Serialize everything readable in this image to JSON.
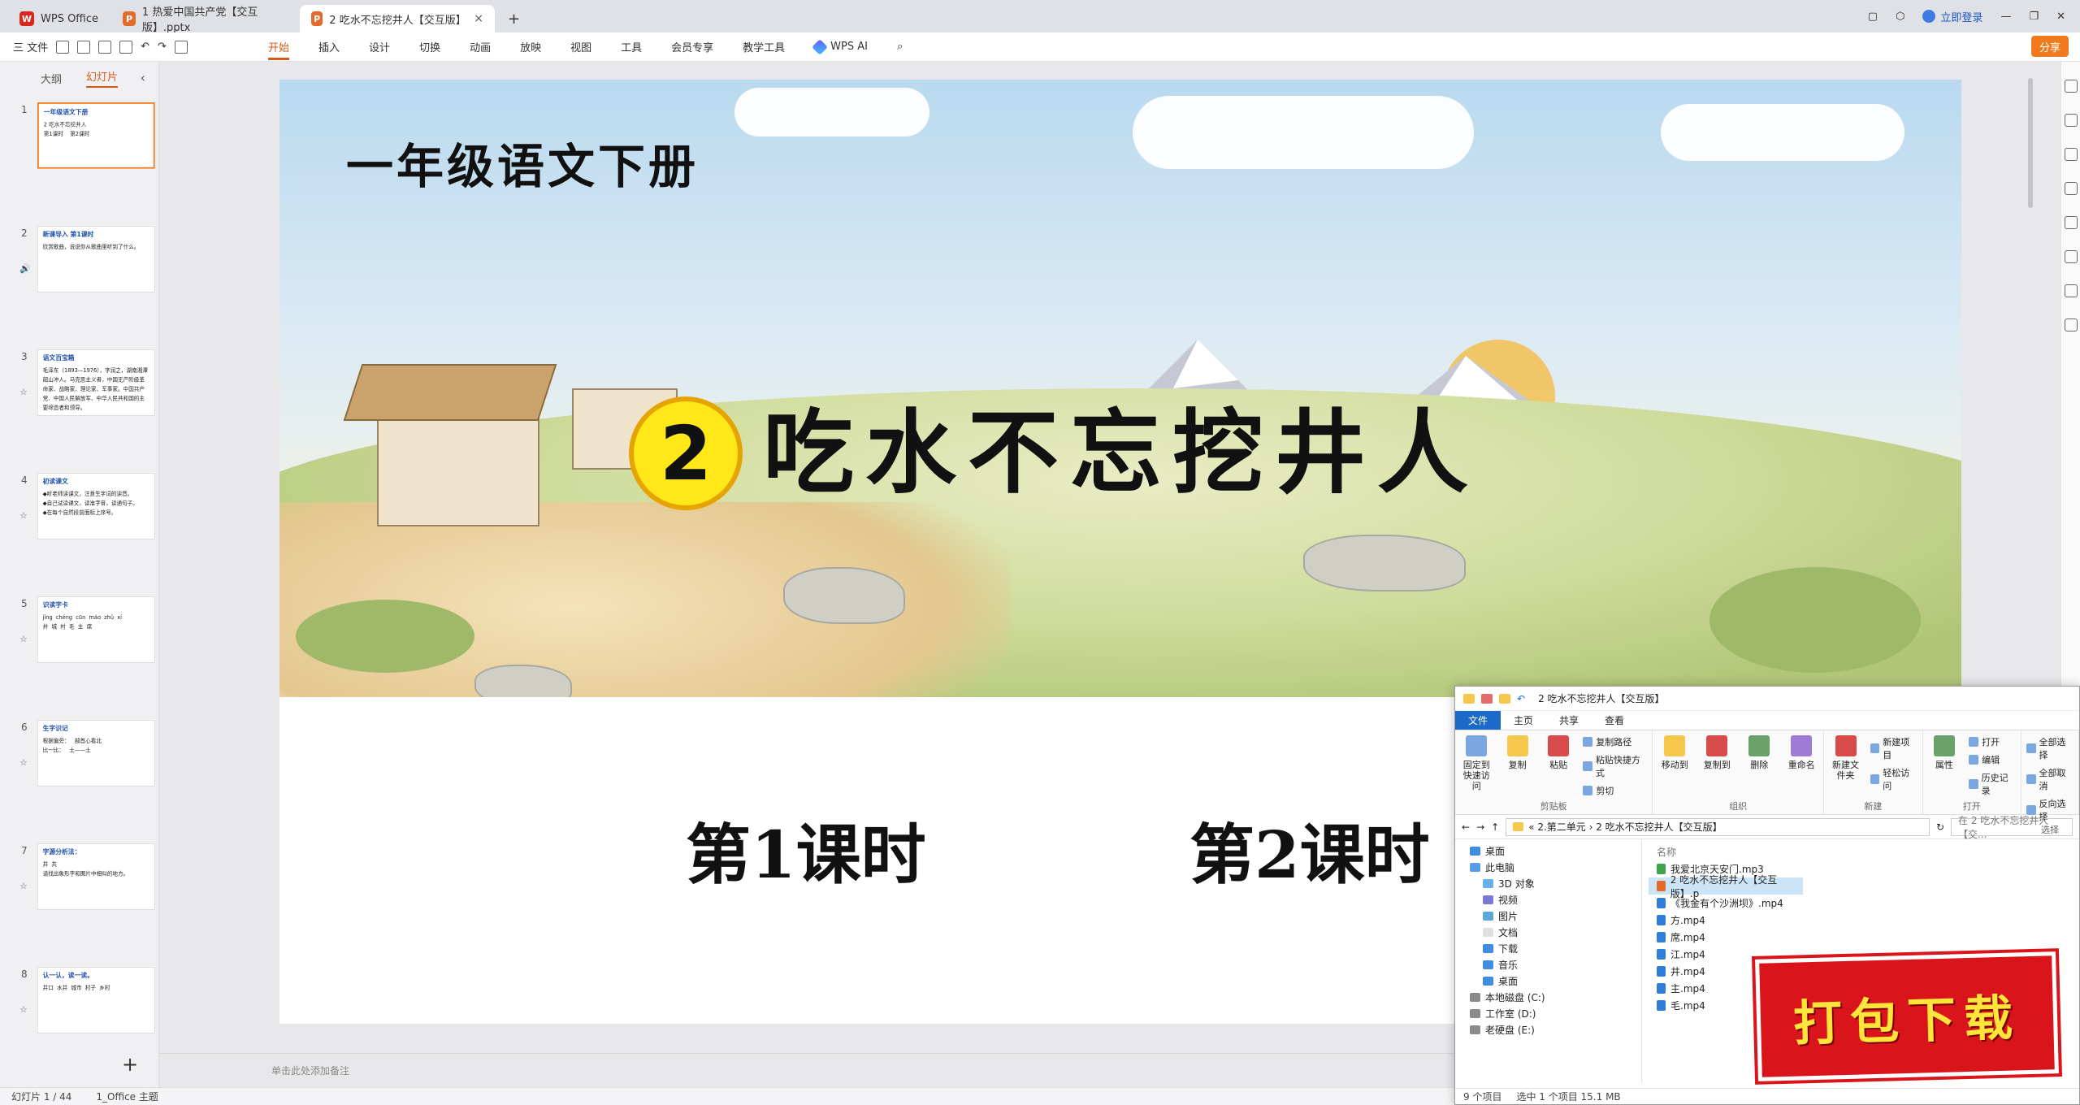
{
  "tabs": [
    {
      "label": "WPS Office",
      "logo": "W",
      "color": "#d9261c"
    },
    {
      "label": "1 热爱中国共产党【交互版】.pptx",
      "logo": "P",
      "color": "#e46a2a"
    },
    {
      "label": "2 吃水不忘挖井人【交互版】.pptx",
      "logo": "P",
      "color": "#e46a2a"
    }
  ],
  "titlebar": {
    "login": "立即登录"
  },
  "ribbon": {
    "file": "三 文件",
    "tabs": [
      "开始",
      "插入",
      "设计",
      "切换",
      "动画",
      "放映",
      "视图",
      "工具",
      "会员专享",
      "教学工具"
    ],
    "ai": "WPS AI",
    "share": "分享"
  },
  "leftpanel": {
    "tab_outline": "大纲",
    "tab_slides": "幻灯片"
  },
  "thumbs": [
    {
      "num": "1",
      "head": "一年级语文下册",
      "body": "2 吃水不忘挖井人\n第1课时    第2课时"
    },
    {
      "num": "2",
      "head": "新课导入      第1课时",
      "body": "欣赏歌曲，说说你从歌曲里听到了什么。"
    },
    {
      "num": "3",
      "head": "语文百宝箱",
      "body": "毛泽东（1893—1976），字润之，湖南湘潭韶山冲人。马克思主义者，中国无产阶级革命家、战略家、理论家、军事家。中国共产党、中国人民解放军、中华人民共和国的主要缔造者和领导。"
    },
    {
      "num": "4",
      "head": "初读课文",
      "body": "◆听老师读课文，注意生字词的读音。\n◆自己试读课文，读准字音，读通句子。\n◆在每个自然段前面标上序号。"
    },
    {
      "num": "5",
      "head": "识读字卡",
      "body": "jǐng  chéng  cūn  máo  zhǔ  xí\n井  城  村  毛  主  席"
    },
    {
      "num": "6",
      "head": "生字识记",
      "body": "根据偏旁：   部首心看北\n比一比：   土——土"
    },
    {
      "num": "7",
      "head": "字源分析法：",
      "body": "井  共\n请找出象形字和图片中相似的地方。"
    },
    {
      "num": "8",
      "head": "认一认，读一读。",
      "body": "井口  水井  城市  村子  乡村"
    }
  ],
  "slide": {
    "grade": "一年级语文下册",
    "number": "2",
    "title": "吃水不忘挖井人",
    "period1": "第1课时",
    "period2": "第2课时"
  },
  "notes": "单击此处添加备注",
  "status": {
    "slide": "幻灯片 1 / 44",
    "theme": "1_Office 主题"
  },
  "explorer": {
    "title": "2 吃水不忘挖井人【交互版】",
    "tabs": [
      "文件",
      "主页",
      "共享",
      "查看"
    ],
    "groups": [
      {
        "name": "剪贴板",
        "big": [
          "固定到快速访问",
          "复制",
          "粘贴"
        ],
        "small": [
          "复制路径",
          "粘贴快捷方式",
          "剪切"
        ]
      },
      {
        "name": "组织",
        "big": [
          "移动到",
          "复制到",
          "删除",
          "重命名"
        ],
        "small": []
      },
      {
        "name": "新建",
        "big": [
          "新建文件夹"
        ],
        "small": [
          "新建项目",
          "轻松访问"
        ]
      },
      {
        "name": "打开",
        "big": [
          "属性"
        ],
        "small": [
          "打开",
          "编辑",
          "历史记录"
        ]
      },
      {
        "name": "选择",
        "big": [],
        "small": [
          "全部选择",
          "全部取消",
          "反向选择"
        ]
      }
    ],
    "path": "« 2.第二单元  ›  2 吃水不忘挖井人【交互版】",
    "search": "在 2 吃水不忘挖井人【交...",
    "nav": [
      "桌面",
      "此电脑",
      "3D 对象",
      "视频",
      "图片",
      "文档",
      "下载",
      "音乐",
      "桌面",
      "本地磁盘 (C:)",
      "工作室 (D:)",
      "老硬盘 (E:)"
    ],
    "col_name": "名称",
    "files": [
      "我爱北京天安门.mp3",
      "2 吃水不忘挖井人【交互版】.p",
      "《我金有个沙洲坝》.mp4",
      "方.mp4",
      "席.mp4",
      "江.mp4",
      "井.mp4",
      "主.mp4",
      "毛.mp4"
    ],
    "status": [
      "9 个项目",
      "选中 1 个项目  15.1 MB"
    ]
  },
  "stamp": "打包下载"
}
